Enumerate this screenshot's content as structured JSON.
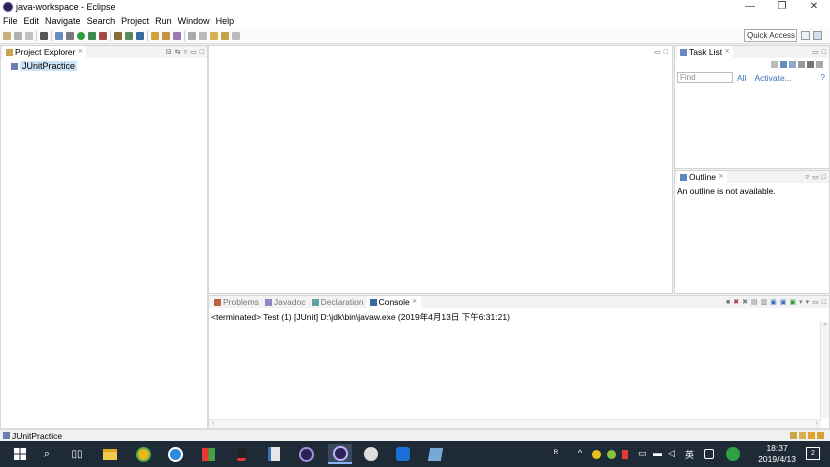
{
  "window": {
    "title": "java-workspace - Eclipse",
    "controls": [
      "—",
      "❐",
      "✕"
    ]
  },
  "menu": [
    "File",
    "Edit",
    "Navigate",
    "Search",
    "Project",
    "Run",
    "Window",
    "Help"
  ],
  "toolbar": {
    "quick_access": "Quick Access"
  },
  "project_explorer": {
    "title": "Project Explorer",
    "close": "⨯",
    "items": [
      {
        "label": "JUnitPractice"
      }
    ]
  },
  "task_list": {
    "title": "Task List",
    "close": "⨯",
    "find_placeholder": "Find",
    "all": "All",
    "activate": "Activate...",
    "help": "?"
  },
  "outline": {
    "title": "Outline",
    "close": "⨯",
    "message": "An outline is not available."
  },
  "bottom_tabs": {
    "problems": "Problems",
    "javadoc": "Javadoc",
    "declaration": "Declaration",
    "console": "Console",
    "close": "⨯"
  },
  "console": {
    "status": "<terminated> Test (1) [JUnit] D:\\jdk\\bin\\javaw.exe (2019年4月13日 下午6:31:21)"
  },
  "status_bar": {
    "text": "JUnitPractice"
  },
  "taskbar": {
    "time": "18:37",
    "date": "2019/4/13",
    "ime": "英",
    "notifications": "2"
  },
  "colors": {
    "accent": "#cce4f7",
    "taskbar": "#1f2a37"
  }
}
